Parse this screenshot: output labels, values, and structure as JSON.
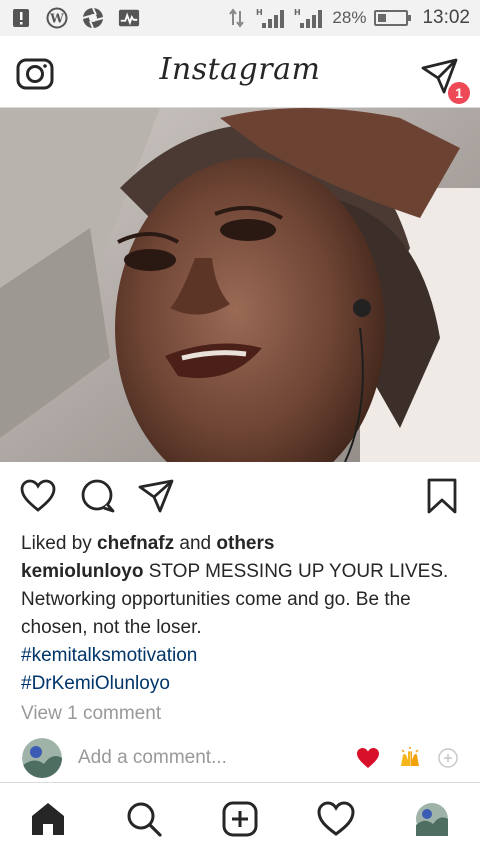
{
  "status_bar": {
    "battery_percent": "28%",
    "time": "13:02",
    "battery_level": 0.28,
    "icons": [
      "alert-icon",
      "wordpress-icon",
      "aperture-icon",
      "activity-icon",
      "data-arrows-icon",
      "signal-h-icon",
      "signal-h-icon",
      "battery-icon"
    ]
  },
  "header": {
    "logo": "Instagram",
    "dm_badge_count": "1",
    "badge_color": "#ed4956"
  },
  "post": {
    "image_alt_icon": "post-photo",
    "liked_by_prefix": "Liked by ",
    "liked_by_user": "chefnafz",
    "liked_by_middle": " and ",
    "liked_by_suffix": "others",
    "author": "kemiolunloyo",
    "caption": " STOP MESSING UP YOUR LIVES. Networking opportunities come and go. Be the chosen, not the loser.",
    "hashtags": [
      "#kemitalksmotivation",
      "#DrKemiOlunloyo"
    ],
    "view_comments": "View 1 comment",
    "hashtag_color": "#003569"
  },
  "comment_box": {
    "placeholder": "Add a comment...",
    "quick_reactions": [
      "heart-emoji",
      "raised-hands-emoji",
      "add-emoji-icon"
    ]
  },
  "bottom_nav": {
    "items": [
      "home-icon",
      "search-icon",
      "new-post-icon",
      "activity-heart-icon",
      "profile-avatar"
    ]
  }
}
